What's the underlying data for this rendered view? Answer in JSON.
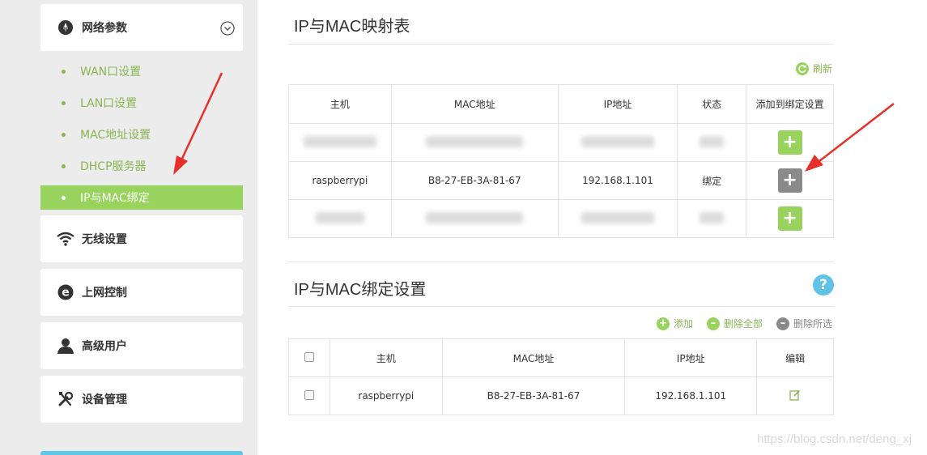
{
  "sidebar": {
    "network_card": {
      "label": "网络参数",
      "icon": "compass-icon"
    },
    "sub_items": [
      {
        "label": "WAN口设置",
        "active": false
      },
      {
        "label": "LAN口设置",
        "active": false
      },
      {
        "label": "MAC地址设置",
        "active": false
      },
      {
        "label": "DHCP服务器",
        "active": false
      },
      {
        "label": "IP与MAC绑定",
        "active": true
      }
    ],
    "cards": [
      {
        "label": "无线设置",
        "icon": "wifi-icon"
      },
      {
        "label": "上网控制",
        "icon": "internet-e-icon"
      },
      {
        "label": "高级用户",
        "icon": "user-icon"
      },
      {
        "label": "设备管理",
        "icon": "tools-icon"
      }
    ]
  },
  "mapping": {
    "title": "IP与MAC映射表",
    "refresh_label": "刷新",
    "headers": [
      "主机",
      "MAC地址",
      "IP地址",
      "状态",
      "添加到绑定设置"
    ],
    "row": {
      "host": "raspberrypi",
      "mac": "B8-27-EB-3A-81-67",
      "ip": "192.168.1.101",
      "status": "绑定"
    }
  },
  "binding": {
    "title": "IP与MAC绑定设置",
    "help": "?",
    "add_label": "添加",
    "delete_all_label": "删除全部",
    "delete_selected_label": "删除所选",
    "headers": [
      "主机",
      "MAC地址",
      "IP地址",
      "编辑"
    ],
    "row": {
      "host": "raspberrypi",
      "mac": "B8-27-EB-3A-81-67",
      "ip": "192.168.1.101"
    }
  },
  "watermark": "https://blog.csdn.net/deng_xj",
  "colors": {
    "accent_green": "#98d35e",
    "text_green": "#8ab553",
    "help_blue": "#5fc3e8",
    "annotation_red": "#e8302a"
  }
}
